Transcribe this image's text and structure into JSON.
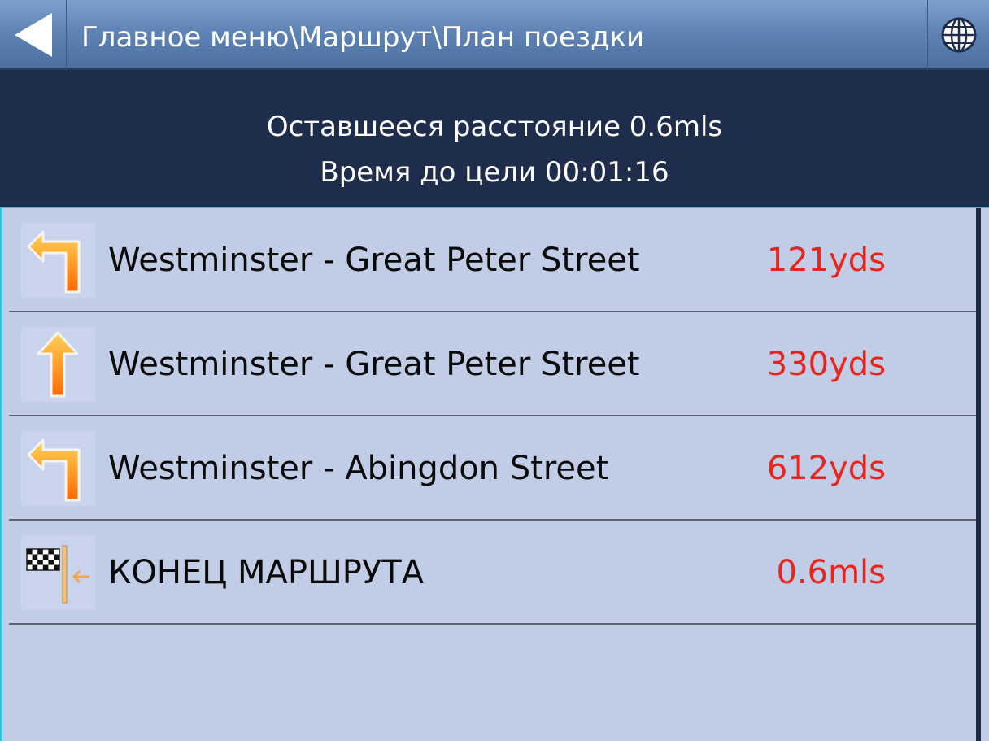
{
  "header": {
    "title": "Главное меню\\Маршрут\\План поездки",
    "back_icon": "back-arrow-icon",
    "globe_icon": "globe-icon"
  },
  "summary": {
    "remaining": "Оставшееся расстояние 0.6mls",
    "time_to_target": "Время до цели 00:01:16"
  },
  "route": {
    "items": [
      {
        "icon": "turn-left-icon",
        "street": "Westminster - Great Peter Street",
        "distance": "121yds"
      },
      {
        "icon": "straight-arrow-icon",
        "street": "Westminster - Great Peter Street",
        "distance": "330yds"
      },
      {
        "icon": "turn-left-icon",
        "street": "Westminster - Abingdon Street",
        "distance": "612yds"
      },
      {
        "icon": "finish-flag-icon",
        "street": "КОНЕЦ МАРШРУТА",
        "distance": "0.6mls"
      }
    ]
  },
  "colors": {
    "header": "#5f84b5",
    "info_bar": "#1f2d4c",
    "list_bg": "#c1cde6",
    "distance": "#e8241b",
    "arrow": "#ff8a1c"
  }
}
